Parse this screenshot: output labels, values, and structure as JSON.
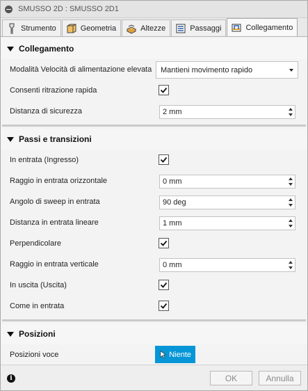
{
  "window": {
    "title": "SMUSSO 2D : SMUSSO 2D1"
  },
  "tabs": [
    {
      "label": "Strumento",
      "icon": "tool-icon"
    },
    {
      "label": "Geometria",
      "icon": "geometry-icon"
    },
    {
      "label": "Altezze",
      "icon": "heights-icon"
    },
    {
      "label": "Passaggi",
      "icon": "passes-icon"
    },
    {
      "label": "Collegamento",
      "icon": "linking-icon",
      "active": true
    }
  ],
  "collegamento": {
    "title": "Collegamento",
    "rapid_feed_label": "Modalità Velocità di alimentazione elevata",
    "rapid_feed_value": "Mantieni movimento rapido",
    "rapid_retract_label": "Consenti ritrazione rapida",
    "rapid_retract_checked": true,
    "safe_distance_label": "Distanza di sicurezza",
    "safe_distance_value": "2 mm"
  },
  "passi": {
    "title": "Passi e transizioni",
    "lead_in_label": "In entrata (Ingresso)",
    "lead_in_checked": true,
    "horiz_radius_label": "Raggio in entrata orizzontale",
    "horiz_radius_value": "0 mm",
    "sweep_angle_label": "Angolo di sweep in entrata",
    "sweep_angle_value": "90 deg",
    "linear_dist_label": "Distanza in entrata lineare",
    "linear_dist_value": "1 mm",
    "perpendicular_label": "Perpendicolare",
    "perpendicular_checked": true,
    "vert_radius_label": "Raggio in entrata verticale",
    "vert_radius_value": "0 mm",
    "lead_out_label": "In uscita (Uscita)",
    "lead_out_checked": true,
    "same_as_lead_in_label": "Come in entrata",
    "same_as_lead_in_checked": true
  },
  "posizioni": {
    "title": "Posizioni",
    "entry_positions_label": "Posizioni voce",
    "entry_positions_button": "Niente"
  },
  "footer": {
    "ok_label": "OK",
    "cancel_label": "Annulla"
  },
  "colors": {
    "accent": "#0696d7"
  }
}
